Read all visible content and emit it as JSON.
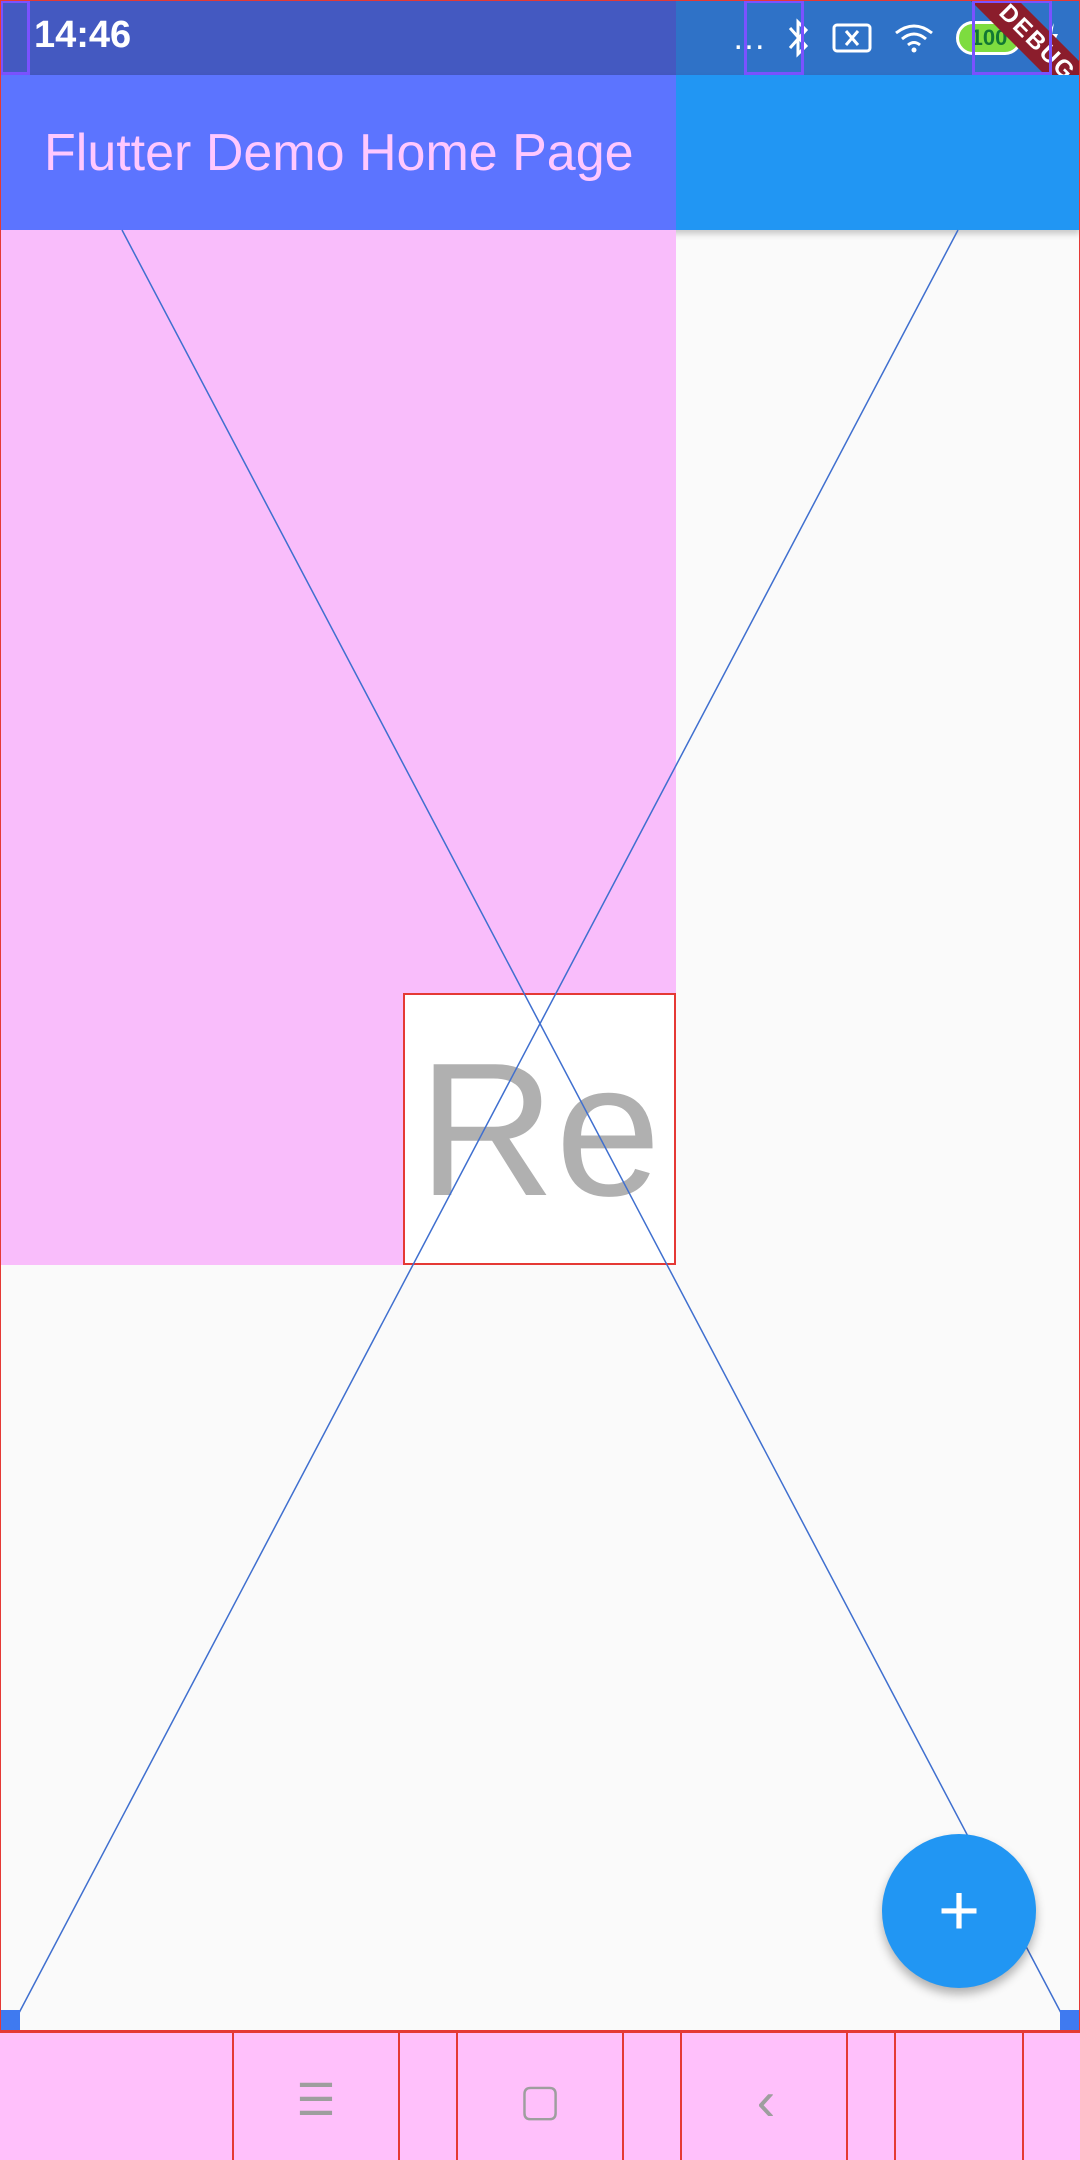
{
  "status_bar": {
    "time": "14:46",
    "battery_level": "100",
    "icons": [
      "signal-dots-icon",
      "bluetooth-icon",
      "no-sim-icon",
      "wifi-icon",
      "battery-icon",
      "charging-icon"
    ]
  },
  "debug_banner": "DEBUG",
  "app_bar": {
    "title": "Flutter Demo Home Page"
  },
  "body": {
    "center_text": "Re"
  },
  "fab": {
    "icon": "+",
    "icon_name": "add-icon"
  },
  "nav_bar": {
    "menu_icon": "☰",
    "home_icon": "▢",
    "back_icon": "‹"
  },
  "colors": {
    "primary": "#2196f3",
    "overlay_pink": "#f9bdfb",
    "debug_outline": "#e53935"
  }
}
